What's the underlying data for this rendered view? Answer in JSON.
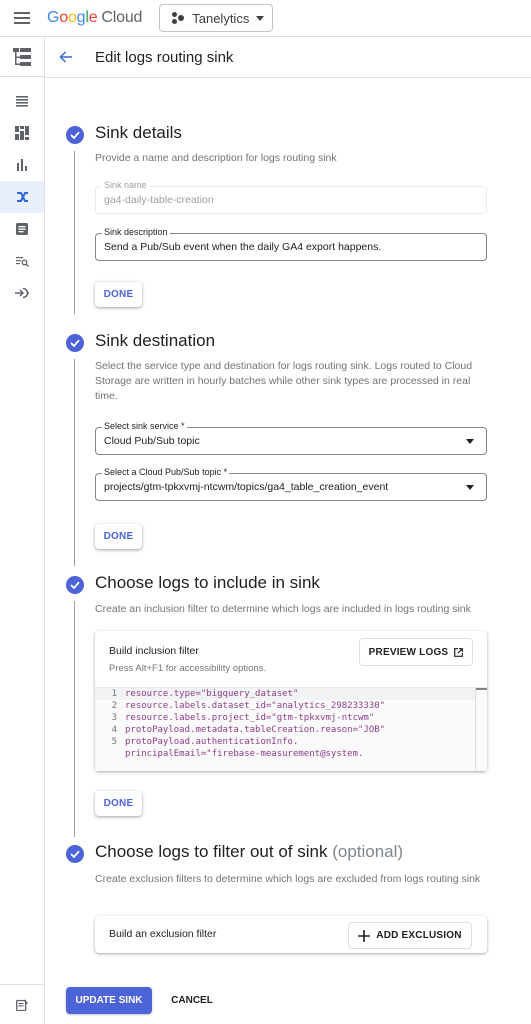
{
  "topbar": {
    "logo_google": [
      "G",
      "o",
      "o",
      "g",
      "l",
      "e"
    ],
    "logo_cloud": "Cloud",
    "project_name": "Tanelytics"
  },
  "leftnav": {
    "items": [
      {
        "icon": "list-icon",
        "active": false
      },
      {
        "icon": "dashboard-icon",
        "active": false
      },
      {
        "icon": "bar-chart-icon",
        "active": false
      },
      {
        "icon": "router-shuffle-icon",
        "active": true
      },
      {
        "icon": "document-icon",
        "active": false
      },
      {
        "icon": "logs-search-icon",
        "active": false
      },
      {
        "icon": "ingest-icon",
        "active": false
      }
    ]
  },
  "header": {
    "title": "Edit logs routing sink"
  },
  "steps": {
    "details": {
      "title": "Sink details",
      "description": "Provide a name and description for logs routing sink",
      "name_label": "Sink name",
      "name_value": "ga4-daily-table-creation",
      "desc_label": "Sink description",
      "desc_value": "Send a Pub/Sub event when the daily GA4 export happens.",
      "done": "DONE"
    },
    "destination": {
      "title": "Sink destination",
      "description": "Select the service type and destination for logs routing sink. Logs routed to Cloud Storage are written in hourly batches while other sink types are processed in real time.",
      "service_label": "Select sink service *",
      "service_value": "Cloud Pub/Sub topic",
      "topic_label": "Select a Cloud Pub/Sub topic *",
      "topic_value": "projects/gtm-tpkxvmj-ntcwm/topics/ga4_table_creation_event",
      "done": "DONE"
    },
    "include": {
      "title": "Choose logs to include in sink",
      "description": "Create an inclusion filter to determine which logs are included in logs routing sink",
      "card_title": "Build inclusion filter",
      "card_sub": "Press Alt+F1 for accessibility options.",
      "preview_label": "PREVIEW LOGS",
      "code": [
        {
          "n": "1",
          "text": "resource.type=\"bigquery_dataset\""
        },
        {
          "n": "2",
          "text": "resource.labels.dataset_id=\"analytics_298233330\""
        },
        {
          "n": "3",
          "text": "resource.labels.project_id=\"gtm-tpkxvmj-ntcwm\""
        },
        {
          "n": "4",
          "text": "protoPayload.metadata.tableCreation.reason=\"JOB\""
        },
        {
          "n": "5",
          "text": "protoPayload.authenticationInfo."
        },
        {
          "n": "",
          "text": "principalEmail=\"firebase-measurement@system."
        }
      ],
      "done": "DONE"
    },
    "exclude": {
      "title": "Choose logs to filter out of sink",
      "optional": "(optional)",
      "description": "Create exclusion filters to determine which logs are excluded from logs routing sink",
      "card_title": "Build an exclusion filter",
      "add_label": "ADD EXCLUSION"
    }
  },
  "footer": {
    "update": "UPDATE SINK",
    "cancel": "CANCEL"
  },
  "colors": {
    "accent": "#4d63d8",
    "code_text": "#8e3c8b"
  }
}
